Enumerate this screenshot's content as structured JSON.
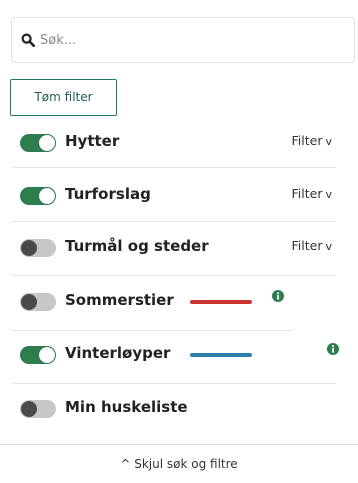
{
  "search": {
    "placeholder": "Søk...",
    "value": ""
  },
  "clear_filter_label": "Tøm filter",
  "layers": [
    {
      "label": "Hytter",
      "enabled": true,
      "filter_label": "Filter",
      "filter_icon": "chevron-down"
    },
    {
      "label": "Turforslag",
      "enabled": true,
      "filter_label": "Filter",
      "filter_icon": "chevron-down"
    },
    {
      "label": "Turmål og steder",
      "enabled": false,
      "filter_label": "Filter",
      "filter_icon": "chevron-down"
    },
    {
      "label": "Sommerstier",
      "enabled": false,
      "legend_color": "#c8352e",
      "info_icon": "info-icon"
    },
    {
      "label": "Vinterløyper",
      "enabled": true,
      "legend_color": "#2f7fb0",
      "info_icon": "info-icon"
    },
    {
      "label": "Min huskeliste",
      "enabled": false
    }
  ],
  "footer": {
    "icon": "chevron-up",
    "label": "Skjul søk og filtre"
  },
  "colors": {
    "toggle_on": "#2e7d4f",
    "toggle_off": "#c7c7c7",
    "accent": "#1f7a6b",
    "info": "#2e7d4f"
  }
}
